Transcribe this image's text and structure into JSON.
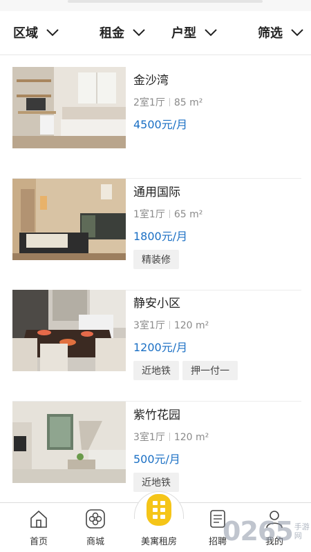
{
  "filters": [
    {
      "label": "区域"
    },
    {
      "label": "租金"
    },
    {
      "label": "户型"
    },
    {
      "label": "筛选"
    }
  ],
  "listings": [
    {
      "title": "金沙湾",
      "rooms": "2室1厅",
      "area": "85 m²",
      "price": "4500元/月",
      "tags": []
    },
    {
      "title": "通用国际",
      "rooms": "1室1厅",
      "area": "65 m²",
      "price": "1800元/月",
      "tags": [
        "精装修"
      ]
    },
    {
      "title": "静安小区",
      "rooms": "3室1厅",
      "area": "120 m²",
      "price": "1200元/月",
      "tags": [
        "近地铁",
        "押一付一"
      ]
    },
    {
      "title": "紫竹花园",
      "rooms": "3室1厅",
      "area": "120 m²",
      "price": "500元/月",
      "tags": [
        "近地铁"
      ]
    }
  ],
  "tabbar": {
    "home": "首页",
    "mall": "商城",
    "rental": "美寓租房",
    "jobs": "招聘",
    "mine": "我的"
  },
  "watermark": {
    "digits": "0265",
    "text": "手游网"
  },
  "colors": {
    "price": "#1a6fc4",
    "accent_yellow": "#f5c518"
  }
}
